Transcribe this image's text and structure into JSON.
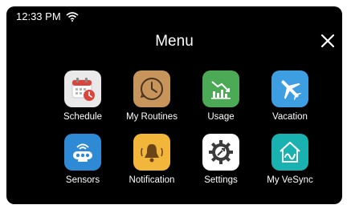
{
  "status_bar": {
    "time": "12:33 PM"
  },
  "header": {
    "title": "Menu"
  },
  "menu": {
    "items": [
      {
        "label": "Schedule"
      },
      {
        "label": "My Routines"
      },
      {
        "label": "Usage"
      },
      {
        "label": "Vacation"
      },
      {
        "label": "Sensors"
      },
      {
        "label": "Notification"
      },
      {
        "label": "Settings"
      },
      {
        "label": "My VeSync"
      }
    ]
  },
  "colors": {
    "screen_bg": "#000000",
    "schedule": "#e9e9ea",
    "routines": "#c7955c",
    "usage": "#4caa57",
    "vacation": "#3d9ee2",
    "sensors": "#2f8ad6",
    "notification": "#f2b73a",
    "settings": "#ffffff",
    "vesync": "#1ab2b1"
  }
}
